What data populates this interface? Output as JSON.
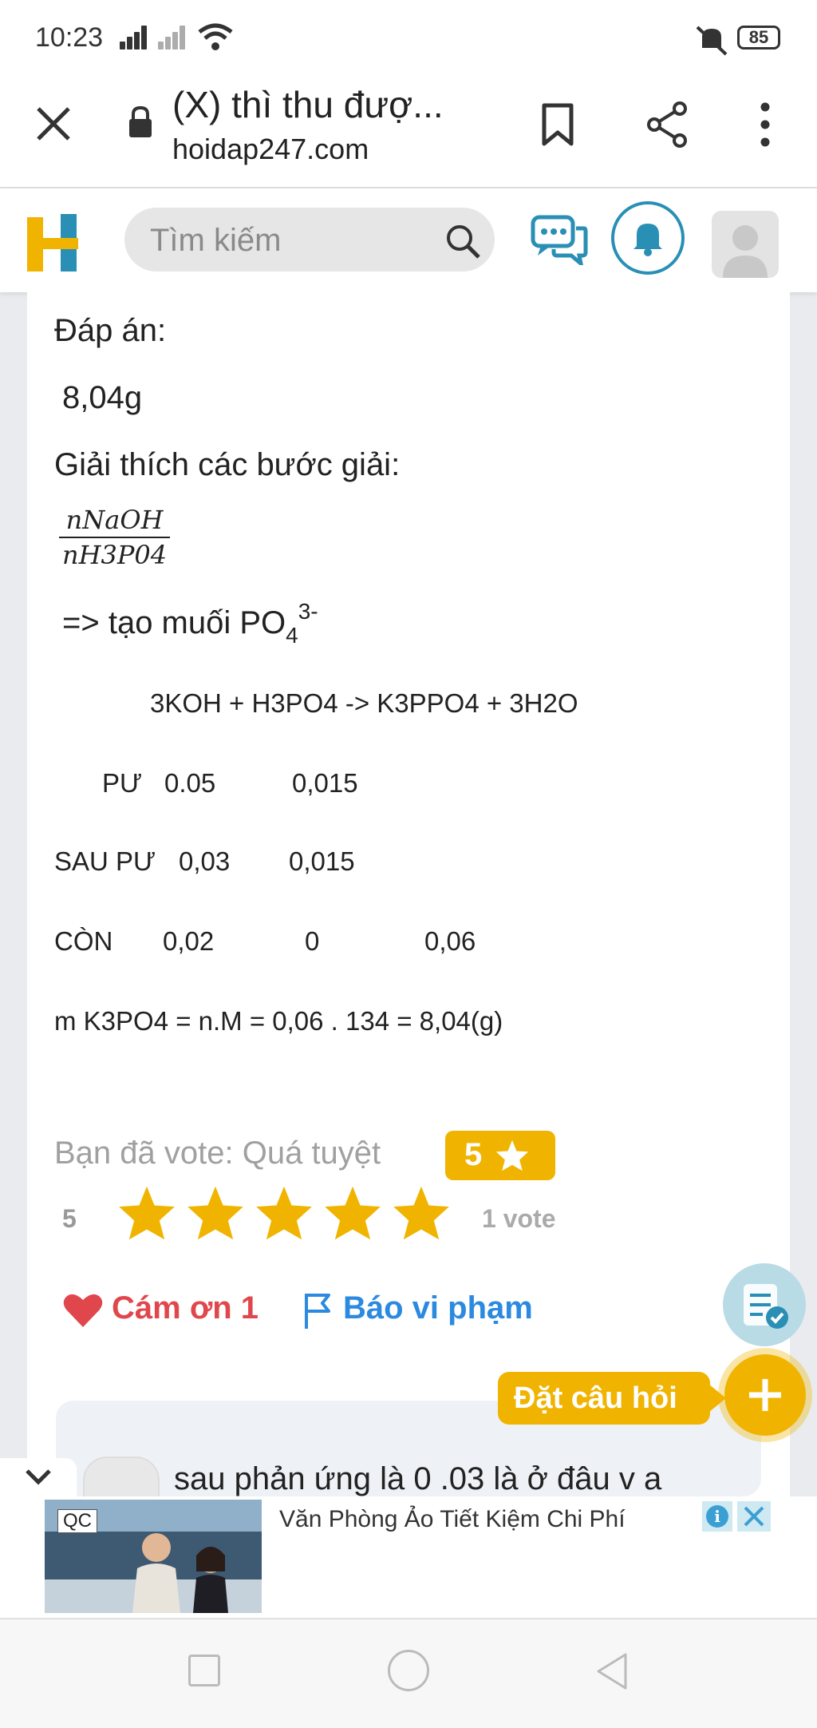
{
  "status_bar": {
    "time": "10:23",
    "battery": "85"
  },
  "browser": {
    "title": "(X) thì thu đượ...",
    "domain": "hoidap247.com"
  },
  "header": {
    "logo": "H",
    "search_placeholder": "Tìm kiếm"
  },
  "answer": {
    "heading": "Đáp án:",
    "result": "8,04g",
    "explain_heading": "Giải thích các bước giải:",
    "fraction_num": "nNaOH",
    "fraction_den": "nH3P04",
    "salt_line": "=> tạo muối PO",
    "salt_sub": "4",
    "salt_sup": "3-",
    "equation": "3KOH + H3PO4 -> K3PPO4 + 3H2O",
    "rows": [
      {
        "label": "PƯ",
        "c1": "0.05",
        "c2": "0,015",
        "c3": ""
      },
      {
        "label": "SAU PƯ",
        "c1": "0,03",
        "c2": "0,015",
        "c3": ""
      },
      {
        "label": "CÒN",
        "c1": "0,02",
        "c2": "0",
        "c3": "0,06"
      }
    ],
    "mass_line": "m K3PO4 = n.M = 0,06 . 134 = 8,04(g)"
  },
  "rating": {
    "voted_label": "Bạn đã vote: Quá tuyệt",
    "badge_value": "5",
    "average": "5",
    "stars": 5,
    "vote_count": "1 vote"
  },
  "actions": {
    "thanks": "Cám ơn 1",
    "report": "Báo vi phạm"
  },
  "fab": {
    "ask": "Đặt câu hỏi"
  },
  "comment": {
    "text": "sau phản ứng là 0 .03 là ở đâu v a"
  },
  "ad": {
    "tag": "QC",
    "text": "Văn Phòng Ảo Tiết Kiệm Chi Phí"
  },
  "colors": {
    "accent": "#f0b400",
    "thanks": "#e0474c",
    "report": "#2b8ae0",
    "brand_blue": "#2a8fb5"
  }
}
